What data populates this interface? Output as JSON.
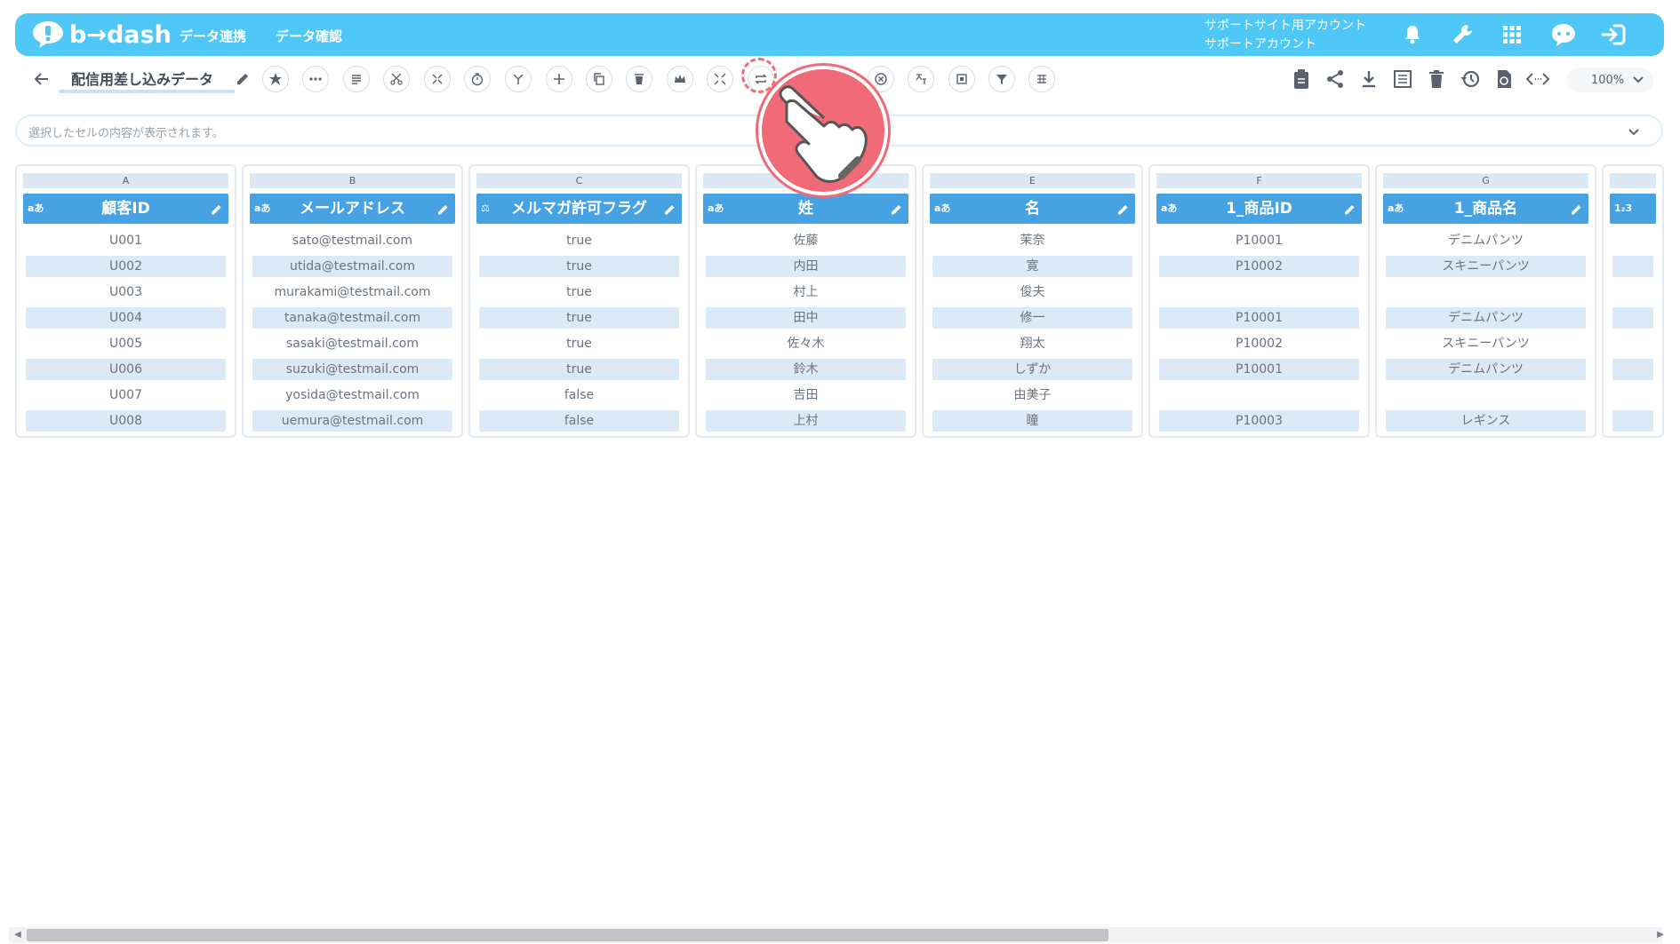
{
  "app": {
    "logo_text": "b→dash",
    "brand_color": "#4fc8f8",
    "accent_color": "#46a2e2"
  },
  "header": {
    "nav": [
      "データ連携",
      "データ確認"
    ],
    "account_line1": "サポートサイト用アカウント",
    "account_line2": "サポートアカウント",
    "icons": [
      "bell-icon",
      "wrench-icon",
      "grid-icon",
      "chat-icon",
      "logout-icon"
    ]
  },
  "toolbar": {
    "title": "配信用差し込みデータ",
    "zoom": "100%",
    "highlighted_tool": "loop-icon"
  },
  "formula_bar": {
    "placeholder": "選択したセルの内容が表示されます。"
  },
  "columns": [
    {
      "letter": "A",
      "name": "顧客ID",
      "type": "aあ",
      "cells": [
        "U001",
        "U002",
        "U003",
        "U004",
        "U005",
        "U006",
        "U007",
        "U008"
      ]
    },
    {
      "letter": "B",
      "name": "メールアドレス",
      "type": "aあ",
      "cells": [
        "sato@testmail.com",
        "utida@testmail.com",
        "murakami@testmail.com",
        "tanaka@testmail.com",
        "sasaki@testmail.com",
        "suzuki@testmail.com",
        "yosida@testmail.com",
        "uemura@testmail.com"
      ]
    },
    {
      "letter": "C",
      "name": "メルマガ許可フラグ",
      "type": "⚖",
      "cells": [
        "true",
        "true",
        "true",
        "true",
        "true",
        "true",
        "false",
        "false"
      ]
    },
    {
      "letter": "",
      "name": "姓",
      "type": "aあ",
      "cells": [
        "佐藤",
        "内田",
        "村上",
        "田中",
        "佐々木",
        "鈴木",
        "吉田",
        "上村"
      ]
    },
    {
      "letter": "E",
      "name": "名",
      "type": "aあ",
      "cells": [
        "茉奈",
        "寛",
        "俊夫",
        "修一",
        "翔太",
        "しずか",
        "由美子",
        "瞳"
      ]
    },
    {
      "letter": "F",
      "name": "1_商品ID",
      "type": "aあ",
      "cells": [
        "P10001",
        "P10002",
        "",
        "P10001",
        "P10002",
        "P10001",
        "",
        "P10003"
      ]
    },
    {
      "letter": "G",
      "name": "1_商品名",
      "type": "aあ",
      "cells": [
        "デニムパンツ",
        "スキニーパンツ",
        "",
        "デニムパンツ",
        "スキニーパンツ",
        "デニムパンツ",
        "",
        "レギンス"
      ]
    },
    {
      "letter": "",
      "name": "",
      "type": "1₂3",
      "cells": [
        "",
        "",
        "",
        "",
        "",
        "",
        "",
        ""
      ]
    }
  ]
}
